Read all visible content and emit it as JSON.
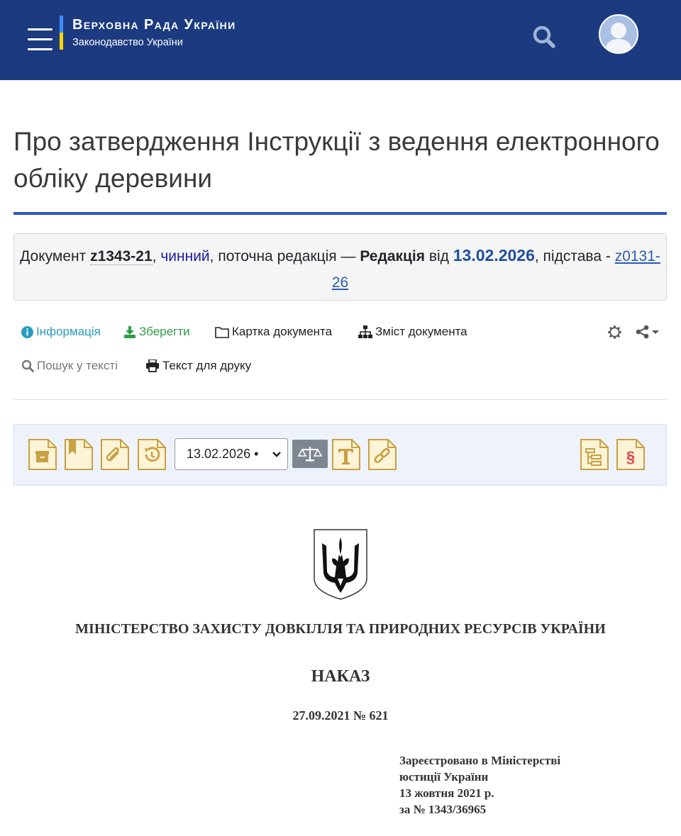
{
  "header": {
    "brand_title": "Верховна Рада України",
    "brand_subtitle": "Законодавство України",
    "menu_icon": "hamburger-icon",
    "search_icon": "search-icon",
    "user_icon": "user-avatar-icon",
    "colors": {
      "background": "#1c3a80",
      "flag_blue": "#3f8cf5",
      "flag_yellow": "#ffd500"
    }
  },
  "page": {
    "title": "Про затвердження Інструкції з ведення електронного обліку деревини",
    "accent_color": "#2a56c6"
  },
  "doc_info": {
    "prefix": "Документ ",
    "doc_number": "z1343-21",
    "comma1": ", ",
    "status": "чинний",
    "middle": ", поточна редакція — ",
    "edition_label": "Редакція",
    "from": " від ",
    "edition_date": "13.02.2026",
    "basis_label": ", підстава - ",
    "basis_link": "z0131-26"
  },
  "toolbar": {
    "info_label": "Інформація",
    "save_label": "Зберегти",
    "card_label": "Картка документа",
    "contents_label": "Зміст документа",
    "search_label": "Пошук у тексті",
    "print_label": "Текст для друку",
    "settings_icon": "gear-icon",
    "share_icon": "share-icon"
  },
  "icon_bar": {
    "selected_date": "13.02.2026 •",
    "icons": [
      "archive-icon",
      "bookmark-icon",
      "attachment-icon",
      "history-icon",
      "scales-icon",
      "text-icon",
      "link-icon",
      "structure-icon",
      "paragraph-icon"
    ]
  },
  "document": {
    "ministry": "МІНІСТЕРСТВО ЗАХИСТУ ДОВКІЛЛЯ ТА ПРИРОДНИХ РЕСУРСІВ УКРАЇНИ",
    "doc_type": "НАКАЗ",
    "date_number": "27.09.2021  № 621",
    "registration": [
      "Зареєстровано в Міністерстві",
      "юстиції України",
      "13 жовтня 2021 р.",
      "за № 1343/36965"
    ]
  }
}
